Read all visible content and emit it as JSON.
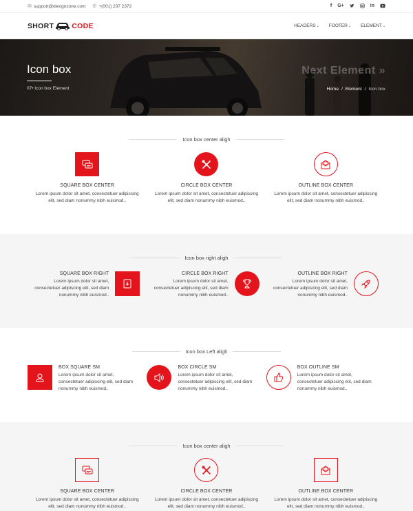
{
  "topbar": {
    "email": "support@dexignzone.com",
    "phone": "+(001) 237 2372",
    "social": [
      "f",
      "G+",
      "t",
      "ig",
      "in",
      "yt"
    ]
  },
  "header": {
    "logo_left": "SHORT",
    "logo_right": "CODE",
    "nav": [
      "HEADERS",
      "FOOTER",
      "ELEMENT"
    ]
  },
  "hero": {
    "title": "Icon box",
    "subtitle": "07• Icon box Element",
    "next": "Next Element »",
    "breadcrumb": [
      "Home",
      "Element",
      "Icon box"
    ]
  },
  "colors": {
    "accent": "#e3141b",
    "gray_bg": "#f5f5f5"
  },
  "sections": [
    {
      "title": "Icon box center aligh",
      "items": [
        {
          "title": "SQUARE BOX CENTER",
          "text": "Lorem ipsum dolor sit amet, consectetuer adipiscing elit, sed diam nonummy nibh euismod..",
          "icon": "chat-icon"
        },
        {
          "title": "CIRCLE BOX CENTER",
          "text": "Lorem ipsum dolor sit amet, consectetuer adipiscing elit, sed diam nonummy nibh euismod..",
          "icon": "tools-icon"
        },
        {
          "title": "OUTLINE BOX CENTER",
          "text": "Lorem ipsum dolor sit amet, consectetuer adipiscing elit, sed diam nonummy nibh euismod..",
          "icon": "mail-icon"
        }
      ]
    },
    {
      "title": "Icon box right aligh",
      "items": [
        {
          "title": "SQUARE BOX RIGHT",
          "text": "Lorem ipsum dolor sit amet, consectetuer adipiscing elit, sed diam nonummy nibh euismod..",
          "icon": "book-icon"
        },
        {
          "title": "CIRCLE BOX RIGHT",
          "text": "Lorem ipsum dolor sit amet, consectetuer adipiscing elit, sed diam nonummy nibh euismod..",
          "icon": "trophy-icon"
        },
        {
          "title": "OUTLINE BOX RIGHT",
          "text": "Lorem ipsum dolor sit amet, consectetuer adipiscing elit, sed diam nonummy nibh euismod..",
          "icon": "rocket-icon"
        }
      ]
    },
    {
      "title": "Icon box Left aligh",
      "items": [
        {
          "title": "BOX SQUARE SM",
          "text": "Lorem ipsum dolor sit amet, consectetuer adipiscing elit, sed diam nonummy nibh euismod..",
          "icon": "user-icon"
        },
        {
          "title": "BOX CIRCLE SM",
          "text": "Lorem ipsum dolor sit amet, consectetuer adipiscing elit, sed diam nonummy nibh euismod..",
          "icon": "speaker-icon"
        },
        {
          "title": "BOX OUTLINE SM",
          "text": "Lorem ipsum dolor sit amet, consectetuer adipiscing elit, sed diam nonummy nibh euismod..",
          "icon": "thumbs-up-icon"
        }
      ]
    },
    {
      "title": "Icon box center aligh",
      "items": [
        {
          "title": "SQUARE BOX CENTER",
          "text": "Lorem ipsum dolor sit amet, consectetuer adipiscing elit, sed diam nonummy nibh euismod..",
          "icon": "chat-icon"
        },
        {
          "title": "CIRCLE BOX CENTER",
          "text": "Lorem ipsum dolor sit amet, consectetuer adipiscing elit, sed diam nonummy nibh euismod..",
          "icon": "tools-icon"
        },
        {
          "title": "OUTLINE BOX CENTER",
          "text": "Lorem ipsum dolor sit amet, consectetuer adipiscing elit, sed diam nonummy nibh euismod..",
          "icon": "mail-icon"
        }
      ]
    }
  ]
}
